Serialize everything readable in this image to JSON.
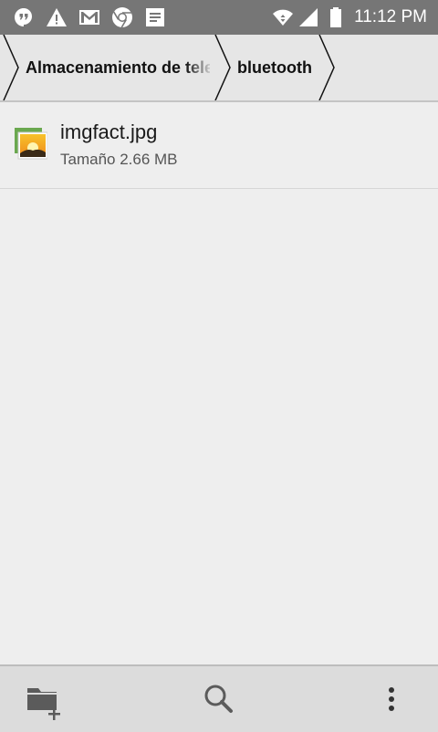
{
  "status_bar": {
    "icons": [
      "hangouts-icon",
      "warning-icon",
      "gmail-icon",
      "chrome-icon",
      "docs-icon",
      "wifi-icon",
      "signal-icon",
      "battery-icon"
    ],
    "time": "11:12 PM"
  },
  "breadcrumb": {
    "items": [
      {
        "label": "Almacenamiento de tele"
      },
      {
        "label": "bluetooth"
      }
    ]
  },
  "files": [
    {
      "name": "imgfact.jpg",
      "size": "Tamaño 2.66 MB",
      "icon": "image-file-icon"
    }
  ],
  "toolbar": {
    "buttons": [
      "new-folder-icon",
      "search-icon",
      "more-options-icon"
    ]
  },
  "colors": {
    "status_bar": "#767676",
    "background": "#eeeeee",
    "breadcrumb_bg": "#e6e6e6",
    "toolbar_bg": "#dcdcdc",
    "icon_gray": "#5b5b5b"
  }
}
